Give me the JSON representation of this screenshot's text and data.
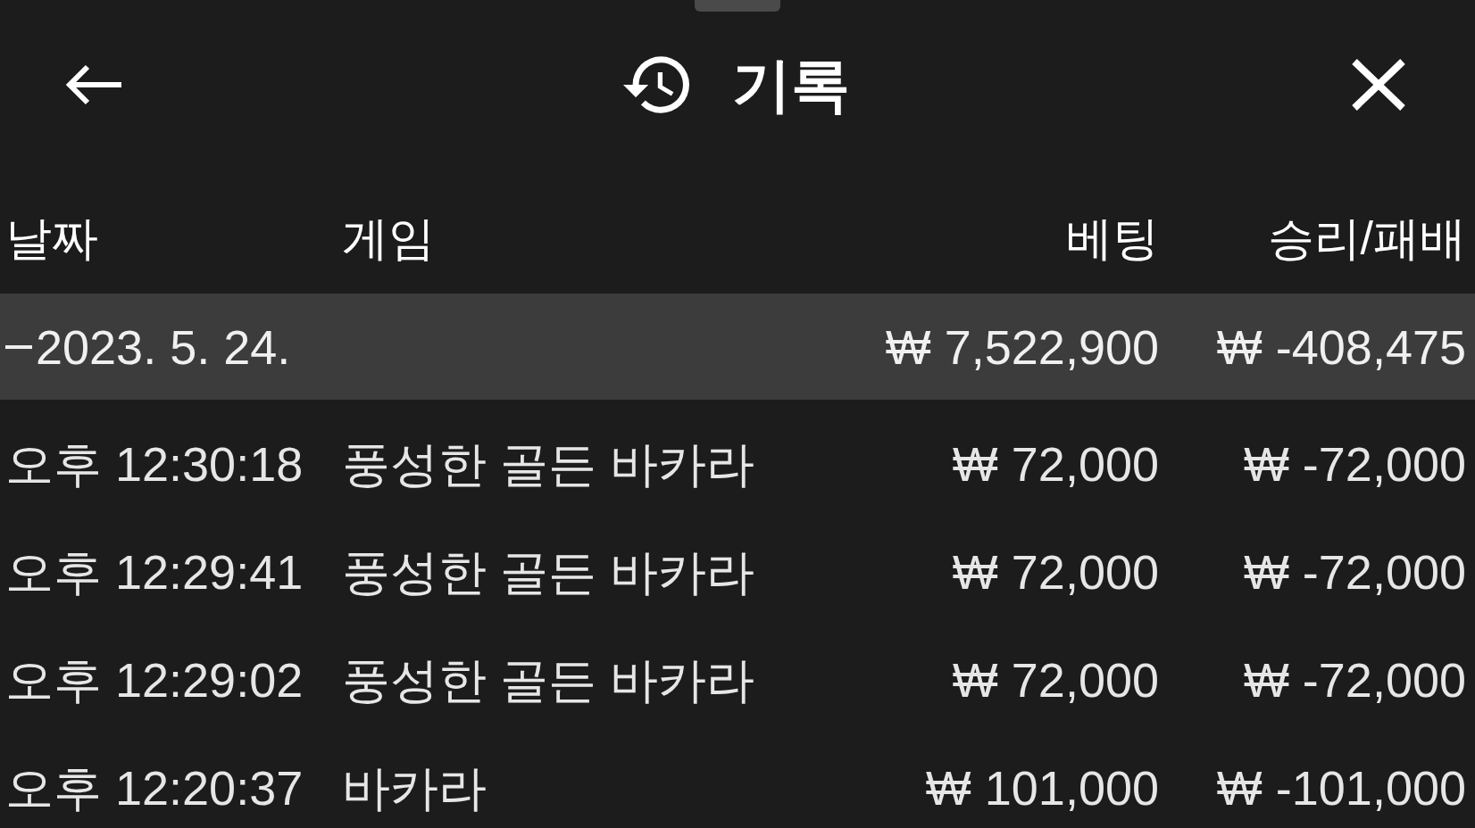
{
  "header": {
    "title": "기록"
  },
  "columns": [
    "날짜",
    "게임",
    "베팅",
    "승리/패배"
  ],
  "groups": [
    {
      "date": "2023. 5. 24.",
      "expanded": true,
      "bet": "₩ 7,522,900",
      "win_loss": "₩ -408,475",
      "rows": [
        {
          "time": "오후 12:30:18",
          "game": "풍성한 골든 바카라",
          "bet": "₩ 72,000",
          "win_loss": "₩ -72,000"
        },
        {
          "time": "오후 12:29:41",
          "game": "풍성한 골든 바카라",
          "bet": "₩ 72,000",
          "win_loss": "₩ -72,000"
        },
        {
          "time": "오후 12:29:02",
          "game": "풍성한 골든 바카라",
          "bet": "₩ 72,000",
          "win_loss": "₩ -72,000"
        },
        {
          "time": "오후 12:20:37",
          "game": "바카라",
          "bet": "₩ 101,000",
          "win_loss": "₩ -101,000"
        }
      ]
    }
  ]
}
